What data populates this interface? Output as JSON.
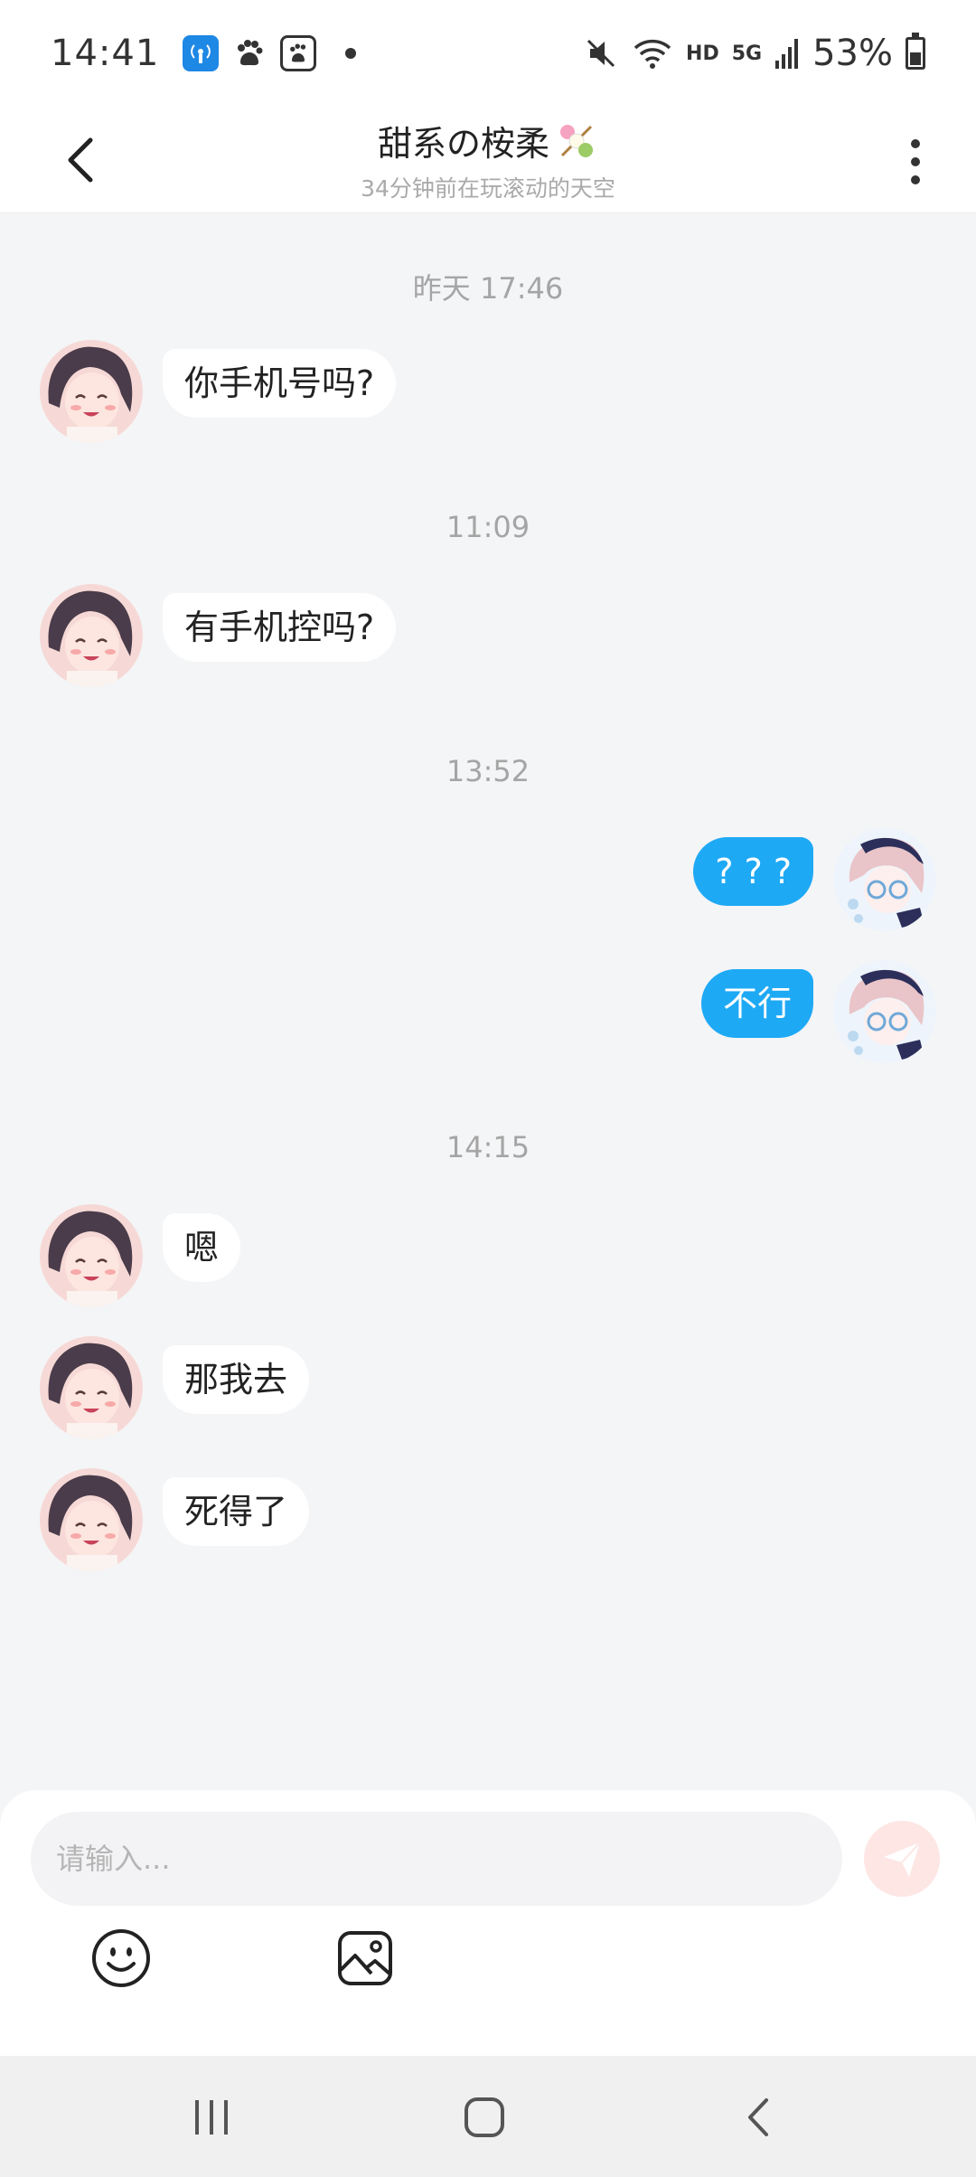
{
  "status_bar": {
    "time": "14:41",
    "network_label": "HD",
    "signal_label": "5G",
    "battery": "53%"
  },
  "header": {
    "title": "甜系の桉柔",
    "subtitle": "34分钟前在玩滚动的天空"
  },
  "messages": [
    {
      "type": "time",
      "text": "昨天 17:46"
    },
    {
      "type": "received",
      "text": "你手机号吗?"
    },
    {
      "type": "time",
      "text": "11:09"
    },
    {
      "type": "received",
      "text": "有手机控吗?"
    },
    {
      "type": "time",
      "text": "13:52"
    },
    {
      "type": "sent",
      "text": "? ? ?"
    },
    {
      "type": "sent",
      "text": "不行"
    },
    {
      "type": "time",
      "text": "14:15"
    },
    {
      "type": "received",
      "text": "嗯"
    },
    {
      "type": "received",
      "text": "那我去"
    },
    {
      "type": "received",
      "text": "死得了"
    }
  ],
  "input": {
    "placeholder": "请输入..."
  },
  "colors": {
    "sent_bubble": "#1ea9f5",
    "received_bubble": "#ffffff",
    "send_button": "#fde6e4",
    "background": "#f4f5f7"
  }
}
